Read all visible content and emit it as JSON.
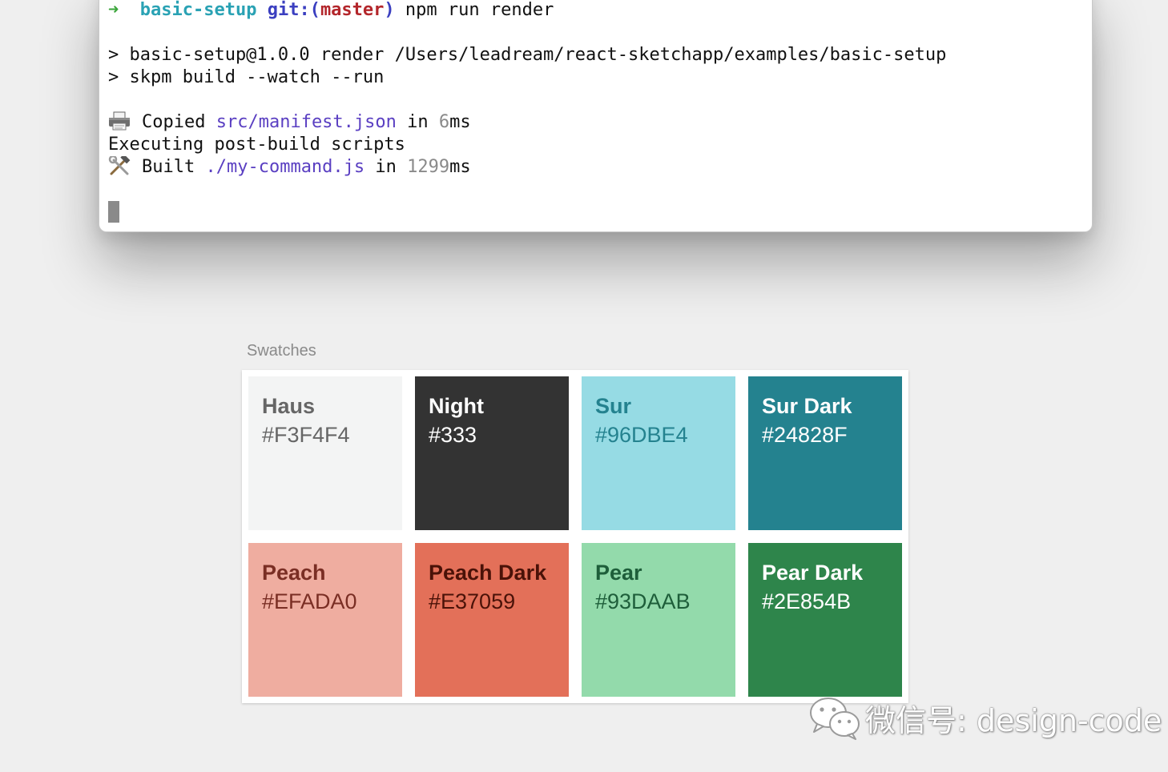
{
  "terminal": {
    "prompt_arrow": "➜",
    "prompt_dir": "basic-setup",
    "prompt_git_open": "git:(",
    "prompt_branch": "master",
    "prompt_git_close": ")",
    "command": "npm run render",
    "line_render": "> basic-setup@1.0.0 render /Users/leadream/react-sketchapp/examples/basic-setup",
    "line_skpm": "> skpm build --watch --run",
    "copied_word": "Copied",
    "copied_path": "src/manifest.json",
    "copied_in": "in",
    "copied_ms": "6",
    "copied_unit": "ms",
    "executing": "Executing post-build scripts",
    "built_word": "Built",
    "built_path": "./my-command.js",
    "built_in": "in",
    "built_ms": "1299",
    "built_unit": "ms"
  },
  "swatches": {
    "title": "Swatches",
    "items": [
      {
        "name": "Haus",
        "hex": "#F3F4F4",
        "fill": "#F3F4F4",
        "text_color": "#666666"
      },
      {
        "name": "Night",
        "hex": "#333",
        "fill": "#333333",
        "text_color": "#FFFFFF"
      },
      {
        "name": "Sur",
        "hex": "#96DBE4",
        "fill": "#96DBE4",
        "text_color": "#24828F"
      },
      {
        "name": "Sur Dark",
        "hex": "#24828F",
        "fill": "#24828F",
        "text_color": "#FFFFFF"
      },
      {
        "name": "Peach",
        "hex": "#EFADA0",
        "fill": "#EFADA0",
        "text_color": "#7A2E24"
      },
      {
        "name": "Peach Dark",
        "hex": "#E37059",
        "fill": "#E37059",
        "text_color": "#4A1208"
      },
      {
        "name": "Pear",
        "hex": "#93DAAB",
        "fill": "#93DAAB",
        "text_color": "#1E5E3A"
      },
      {
        "name": "Pear Dark",
        "hex": "#2E854B",
        "fill": "#2E854B",
        "text_color": "#FFFFFF"
      }
    ]
  },
  "watermark": {
    "icon": "wechat-icon",
    "text": "微信号: design-code"
  },
  "icons": {
    "copied": "printer-icon",
    "built": "hammer-and-wrench-icon"
  }
}
